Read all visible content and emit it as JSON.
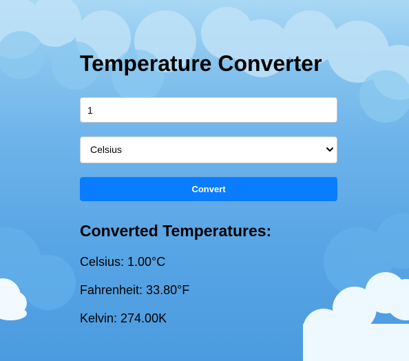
{
  "converter": {
    "title": "Temperature Converter",
    "input_value": "1",
    "unit_selected": "Celsius",
    "convert_label": "Convert"
  },
  "results": {
    "heading": "Converted Temperatures:",
    "celsius": "Celsius: 1.00°C",
    "fahrenheit": "Fahrenheit: 33.80°F",
    "kelvin": "Kelvin: 274.00K"
  },
  "theme": {
    "button_color": "#0a7cff",
    "background_top": "#a9d8f4",
    "background_bottom": "#4a9be0",
    "cloud_color": "#ffffff"
  },
  "icons": {
    "dropdown": "chevron-down-icon"
  }
}
